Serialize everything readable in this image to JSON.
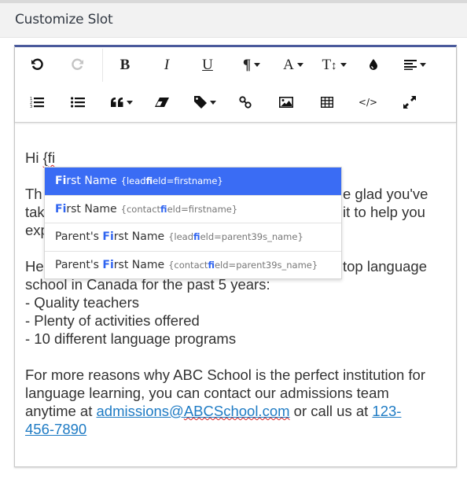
{
  "panel": {
    "title": "Customize Slot"
  },
  "colors": {
    "editor_top_border": "#4a5a9c",
    "dropdown_active_bg": "#3a6cf4",
    "match_highlight": "#2f64f0",
    "link": "#1e7bc4",
    "spellcheck_underline": "#d62020"
  },
  "toolbar": {
    "row1": [
      {
        "name": "undo",
        "icon": "undo-icon",
        "enabled": true
      },
      {
        "name": "redo",
        "icon": "redo-icon",
        "enabled": false
      },
      {
        "name": "bold",
        "icon": "bold-icon",
        "glyph": "B"
      },
      {
        "name": "italic",
        "icon": "italic-icon",
        "glyph": "I"
      },
      {
        "name": "underline",
        "icon": "underline-icon",
        "glyph": "U"
      },
      {
        "name": "paragraph-format",
        "icon": "pilcrow-icon",
        "glyph": "¶",
        "dropdown": true
      },
      {
        "name": "font-family",
        "icon": "font-icon",
        "glyph": "A",
        "dropdown": true
      },
      {
        "name": "font-size",
        "icon": "text-height-icon",
        "glyph": "T",
        "dropdown": true
      },
      {
        "name": "text-color",
        "icon": "tint-icon"
      },
      {
        "name": "align",
        "icon": "align-left-icon",
        "dropdown": true
      }
    ],
    "row2": [
      {
        "name": "ordered-list",
        "icon": "ordered-list-icon"
      },
      {
        "name": "unordered-list",
        "icon": "unordered-list-icon"
      },
      {
        "name": "quote",
        "icon": "quote-icon",
        "dropdown": true
      },
      {
        "name": "clear-formatting",
        "icon": "eraser-icon"
      },
      {
        "name": "merge-tags",
        "icon": "tag-icon",
        "dropdown": true
      },
      {
        "name": "insert-link",
        "icon": "link-icon"
      },
      {
        "name": "insert-image",
        "icon": "image-icon"
      },
      {
        "name": "insert-table",
        "icon": "table-icon"
      },
      {
        "name": "code-view",
        "icon": "code-icon",
        "glyph": "</>"
      },
      {
        "name": "fullscreen",
        "icon": "expand-icon"
      }
    ]
  },
  "body": {
    "greeting_prefix": "Hi ",
    "typed_token": "{fi",
    "para1_line1_left": "Th",
    "para1_line1_right": "e glad you've",
    "para1_line2_left": "tak",
    "para1_line2_right": "it to help you",
    "para1_line3_left": "exp",
    "para2_line1_left": "He",
    "para2_line1_right": "top language",
    "para2_line2": "school in Canada for the past 5 years:",
    "bullets": [
      "- Quality teachers",
      "- Plenty of activities offered",
      "- 10 different language programs"
    ],
    "para3_text": "For more reasons why ABC School is the perfect institution for language learning, you can contact our admissions team anytime at ",
    "email_link": "admissions@ABCSchool.com",
    "para3_mid": " or call us at ",
    "phone_link_part1": "123-",
    "phone_link_part2": "456-7890"
  },
  "autocomplete": {
    "query": "fi",
    "items": [
      {
        "prefix": "",
        "match": "Fi",
        "rest": "rst Name",
        "code_prefix": "{lead",
        "code_match": "fi",
        "code_rest": "eld=firstname}",
        "active": true
      },
      {
        "prefix": "",
        "match": "Fi",
        "rest": "rst Name",
        "code_prefix": "{contact",
        "code_match": "fi",
        "code_rest": "eld=firstname}",
        "active": false
      },
      {
        "prefix": "Parent's ",
        "match": "Fi",
        "rest": "rst Name",
        "code_prefix": "{lead",
        "code_match": "fi",
        "code_rest": "eld=parent39s_name}",
        "active": false
      },
      {
        "prefix": "Parent's ",
        "match": "Fi",
        "rest": "rst Name",
        "code_prefix": "{contact",
        "code_match": "fi",
        "code_rest": "eld=parent39s_name}",
        "active": false
      }
    ]
  }
}
